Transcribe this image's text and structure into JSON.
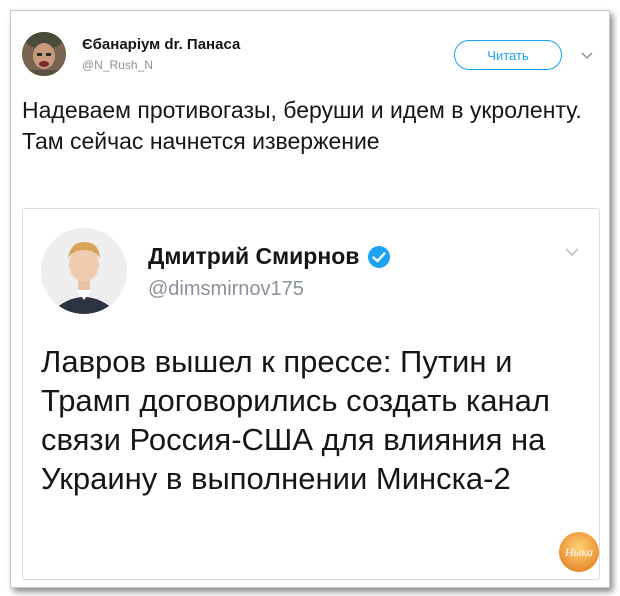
{
  "tweet": {
    "author_name": "Єбанаріум dr. Панаса",
    "author_handle": "@N_Rush_N",
    "follow_label": "Читать",
    "text": "Надеваем противогазы, беруши и идем в укроленту. Там сейчас начнется извержение"
  },
  "quoted": {
    "author_name": "Дмитрий Смирнов",
    "author_handle": "@dimsmirnov175",
    "text": "Лавров вышел к прессе: Путин и Трамп договорились создать канал связи Россия-США для влияния на Украину в выполнении Минска-2"
  },
  "watermark": {
    "label": "Ныка"
  },
  "colors": {
    "accent": "#1da1f2",
    "text": "#14171a",
    "muted": "#8a9199"
  },
  "icons": [
    "chevron-down-icon",
    "verified-badge-icon"
  ]
}
